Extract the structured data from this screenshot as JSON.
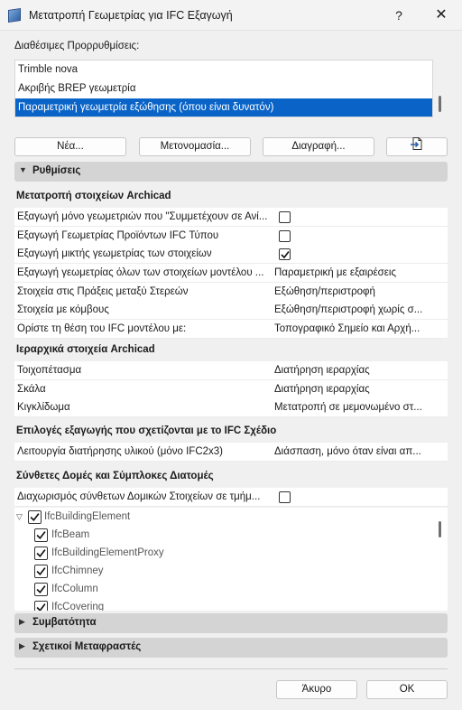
{
  "window": {
    "title": "Μετατροπή Γεωμετρίας για IFC Εξαγωγή",
    "help": "?",
    "close": "✕"
  },
  "presets": {
    "label": "Διαθέσιμες Προρρυθμίσεις:",
    "items": [
      {
        "label": "Trimble nova"
      },
      {
        "label": "Ακριβής BREP γεωμετρία"
      },
      {
        "label": "Παραμετρική γεωμετρία εξώθησης (όπου είναι δυνατόν)"
      }
    ],
    "selected_index": 2,
    "buttons": {
      "new": "Νέα...",
      "rename": "Μετονομασία...",
      "delete": "Διαγραφή..."
    }
  },
  "sections": {
    "settings": "Ρυθμίσεις",
    "compatibility": "Συμβατότητα",
    "translators": "Σχετικοί Μεταφραστές"
  },
  "groups": {
    "archicad_elements": {
      "title": "Μετατροπή στοιχείων Archicad",
      "rows": [
        {
          "key": "Εξαγωγή μόνο γεωμετριών που \"Συμμετέχουν σε Ανί...",
          "checked": false
        },
        {
          "key": "Εξαγωγή Γεωμετρίας Προϊόντων IFC Τύπου",
          "checked": false
        },
        {
          "key": "Εξαγωγή μικτής γεωμετρίας των στοιχείων",
          "checked": true
        },
        {
          "key": "Εξαγωγή γεωμετρίας όλων των στοιχείων μοντέλου ...",
          "value": "Παραμετρική με εξαιρέσεις"
        },
        {
          "key": "Στοιχεία στις Πράξεις μεταξύ Στερεών",
          "value": "Εξώθηση/περιστροφή"
        },
        {
          "key": "Στοιχεία με κόμβους",
          "value": "Εξώθηση/περιστροφή χωρίς σ..."
        },
        {
          "key": "Ορίστε τη θέση του IFC μοντέλου με:",
          "value": "Τοπογραφικό Σημείο και Αρχή..."
        }
      ]
    },
    "hierarchical": {
      "title": "Ιεραρχικά στοιχεία Archicad",
      "rows": [
        {
          "key": "Τοιχοπέτασμα",
          "value": "Διατήρηση ιεραρχίας"
        },
        {
          "key": "Σκάλα",
          "value": "Διατήρηση ιεραρχίας"
        },
        {
          "key": "Κιγκλίδωμα",
          "value": "Μετατροπή σε μεμονωμένο στ..."
        }
      ]
    },
    "ifc_plan": {
      "title": "Επιλογές εξαγωγής που σχετίζονται με το IFC Σχέδιο",
      "rows": [
        {
          "key": "Λειτουργία διατήρησης υλικού (μόνο IFC2x3)",
          "value": "Διάσπαση, μόνο όταν είναι απ..."
        }
      ]
    },
    "composite": {
      "title": "Σύνθετες Δομές και Σύμπλοκες Διατομές",
      "rows": [
        {
          "key": "Διαχωρισμός σύνθετων Δομικών Στοιχείων σε τμήμ...",
          "checked": false
        }
      ]
    }
  },
  "tree": {
    "root": "IfcBuildingElement",
    "children": [
      "IfcBeam",
      "IfcBuildingElementProxy",
      "IfcChimney",
      "IfcColumn",
      "IfcCovering"
    ]
  },
  "footer": {
    "cancel": "Άκυρο",
    "ok": "OK"
  }
}
